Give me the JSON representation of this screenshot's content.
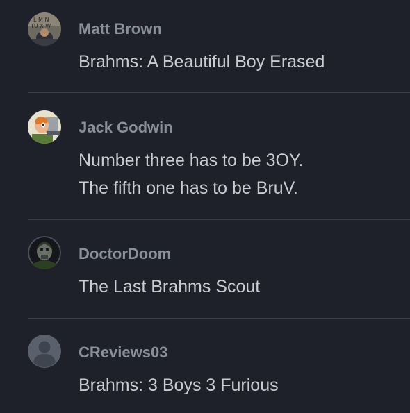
{
  "comments": [
    {
      "username": "Matt Brown",
      "lines": [
        "Brahms: A Beautiful Boy Erased"
      ],
      "avatar": "photo-avatar-icon"
    },
    {
      "username": "Jack Godwin",
      "lines": [
        "Number three has to be 3OY.",
        "The fifth one has to be BruV."
      ],
      "avatar": "cartoon-avatar-icon"
    },
    {
      "username": "DoctorDoom",
      "lines": [
        "The Last Brahms Scout"
      ],
      "avatar": "masked-avatar-icon"
    },
    {
      "username": "CReviews03",
      "lines": [
        "Brahms: 3 Boys 3 Furious"
      ],
      "avatar": "default-user-icon"
    }
  ],
  "colors": {
    "background": "#1e2129",
    "username": "#8a909a",
    "text": "#c9ccd1",
    "divider": "#3a3e46"
  }
}
